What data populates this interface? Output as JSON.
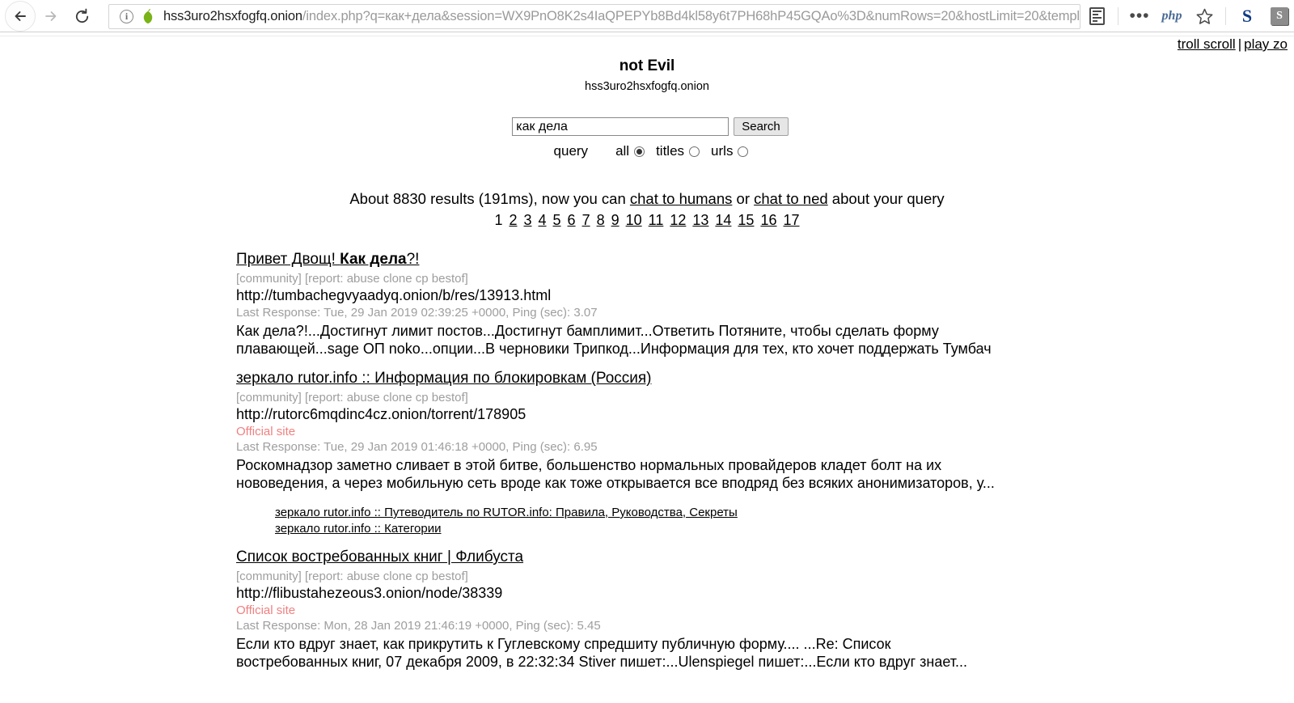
{
  "browser": {
    "back_icon": "back-arrow-icon",
    "forward_icon": "forward-arrow-icon",
    "reload_icon": "reload-icon",
    "info_icon_glyph": "i",
    "security_icon": "onion-icon",
    "url_host": "hss3uro2hsxfogfq.onion",
    "url_path": "/index.php?q=как+дела&session=WX9PnO8K2s4IaQPEPYb8Bd4kl58y6t7PH68hP45GQAo%3D&numRows=20&hostLimit=20&templ",
    "reader_icon": "reader-view-icon",
    "dots_label": "•••",
    "php_label": "php",
    "star_icon": "bookmark-star-icon",
    "ext_s_label": "S",
    "ext_s_box_label": "S"
  },
  "page_links": {
    "troll_scroll": "troll scroll",
    "separator": "|",
    "play_zone": "play zo"
  },
  "header": {
    "title": "not Evil",
    "subtitle": "hss3uro2hsxfogfq.onion"
  },
  "search": {
    "value": "как дела",
    "placeholder": "",
    "button_label": "Search",
    "query_label": "query",
    "options": [
      {
        "label": "all",
        "checked": true
      },
      {
        "label": "titles",
        "checked": false
      },
      {
        "label": "urls",
        "checked": false
      }
    ]
  },
  "summary": {
    "prefix": "About 8830 results (191ms), now you can ",
    "link1": "chat to humans",
    "middle": " or ",
    "link2": "chat to ned",
    "suffix": " about your query",
    "result_count": "8830",
    "time_ms": "191ms"
  },
  "pagination": {
    "current": "1",
    "pages": [
      "2",
      "3",
      "4",
      "5",
      "6",
      "7",
      "8",
      "9",
      "10",
      "11",
      "12",
      "13",
      "14",
      "15",
      "16",
      "17"
    ]
  },
  "results": [
    {
      "title_plain": "Привет Двощ! ",
      "title_bold": "Как дела",
      "title_tail": "?!",
      "tags": "[community] [report: abuse clone cp bestof]",
      "url": "http://tumbachegvyaadyq.onion/b/res/13913.html",
      "official": "",
      "meta": "Last Response: Tue, 29 Jan 2019 02:39:25 +0000, Ping (sec): 3.07",
      "snippet": "Как дела?!...Достигнут лимит постов...Достигнут бамплимит...Ответить Потяните, чтобы сделать форму плавающей...sage ОП noko...опции...В черновики Трипкод...Информация для тех, кто хочет поддержать Тумбач",
      "sublinks": []
    },
    {
      "title_plain": "зеркало rutor.info :: Информация по блокировкам (Россия)",
      "title_bold": "",
      "title_tail": "",
      "tags": "[community] [report: abuse clone cp bestof]",
      "url": "http://rutorc6mqdinc4cz.onion/torrent/178905",
      "official": "Official site",
      "meta": "Last Response: Tue, 29 Jan 2019 01:46:18 +0000, Ping (sec): 6.95",
      "snippet": "Роскомнадзор заметно сливает в этой битве, большенство нормальных провайдеров кладет болт на их нововедения, а через мобильную сеть вроде как тоже открывается все вподряд без всяких анонимизаторов, у...",
      "sublinks": [
        "зеркало rutor.info :: Путеводитель по RUTOR.info: Правила, Руководства, Секреты",
        "зеркало rutor.info :: Категории"
      ]
    },
    {
      "title_plain": "Список востребованных книг | Флибуста",
      "title_bold": "",
      "title_tail": "",
      "tags": "[community] [report: abuse clone cp bestof]",
      "url": "http://flibustahezeous3.onion/node/38339",
      "official": "Official site",
      "meta": "Last Response: Mon, 28 Jan 2019 21:46:19 +0000, Ping (sec): 5.45",
      "snippet": "Если кто вдруг знает, как прикрутить к Гуглевскому спредшиту публичную форму.... ...Re: Список востребованных книг, 07 декабря 2009, в 22:32:34 Stiver пишет:...Ulenspiegel пишет:...Если кто вдруг знает...",
      "sublinks": []
    }
  ],
  "colors": {
    "official_site": "#f08080",
    "muted_text": "#9e9e9e",
    "link_text": "#000000",
    "onion_green": "#7ab317"
  }
}
